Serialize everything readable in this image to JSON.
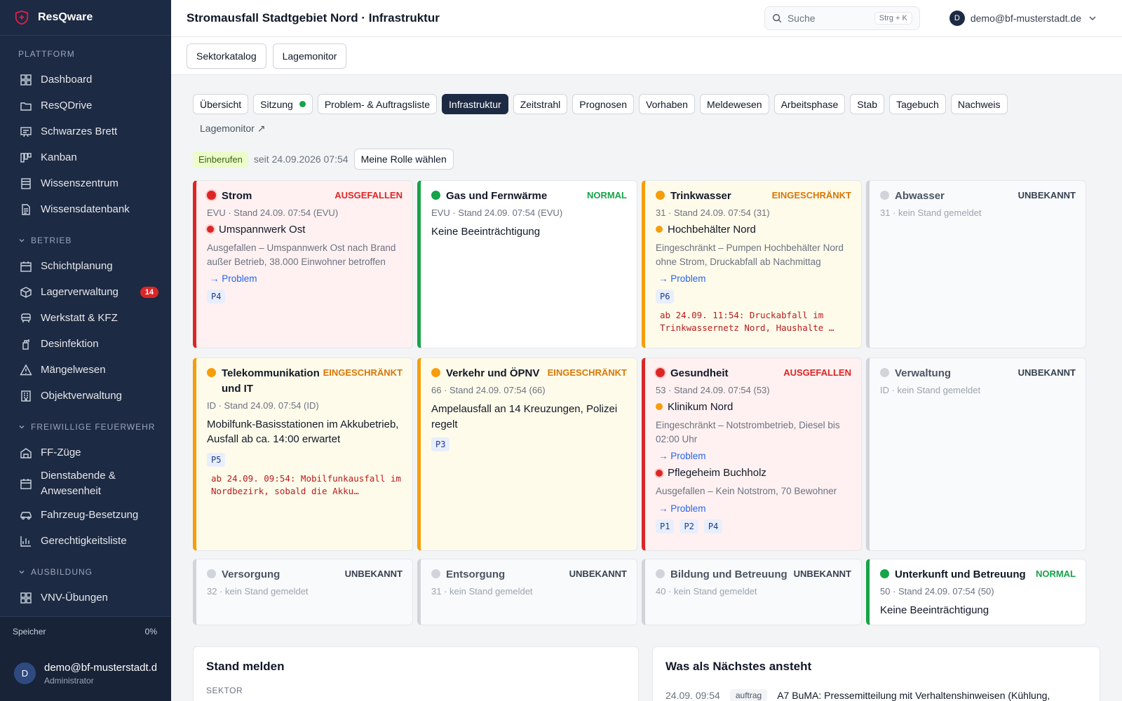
{
  "brand": {
    "name": "ResQware"
  },
  "sidebar": {
    "sections": [
      {
        "title": "PLATTFORM",
        "collapsible": false,
        "items": [
          {
            "label": "Dashboard",
            "icon": "dashboard-icon"
          },
          {
            "label": "ResQDrive",
            "icon": "folder-icon"
          },
          {
            "label": "Schwarzes Brett",
            "icon": "board-icon"
          },
          {
            "label": "Kanban",
            "icon": "kanban-icon"
          },
          {
            "label": "Wissenszentrum",
            "icon": "book-icon"
          },
          {
            "label": "Wissensdatenbank",
            "icon": "document-icon"
          }
        ]
      },
      {
        "title": "BETRIEB",
        "collapsible": true,
        "items": [
          {
            "label": "Schichtplanung",
            "icon": "calendar-icon"
          },
          {
            "label": "Lagerverwaltung",
            "icon": "box-icon",
            "badge": "14"
          },
          {
            "label": "Werkstatt & KFZ",
            "icon": "vehicle-icon"
          },
          {
            "label": "Desinfektion",
            "icon": "spray-icon"
          },
          {
            "label": "Mängelwesen",
            "icon": "warning-icon"
          },
          {
            "label": "Objektverwaltung",
            "icon": "building-icon"
          }
        ]
      },
      {
        "title": "FREIWILLIGE FEUERWEHR",
        "collapsible": true,
        "items": [
          {
            "label": "FF-Züge",
            "icon": "firehouse-icon"
          },
          {
            "label": "Dienstabende & Anwesenheit",
            "icon": "calendar-icon"
          },
          {
            "label": "Fahrzeug-Besetzung",
            "icon": "car-icon"
          },
          {
            "label": "Gerechtigkeitsliste",
            "icon": "bar-chart-icon"
          }
        ]
      },
      {
        "title": "AUSBILDUNG",
        "collapsible": true,
        "items": [
          {
            "label": "VNV-Übungen",
            "icon": "grid-icon"
          }
        ]
      }
    ],
    "storage": {
      "label": "Speicher",
      "value": "0%"
    },
    "user": {
      "initial": "D",
      "name": "demo@bf-musterstadt.de",
      "role": "Administrator"
    }
  },
  "topbar": {
    "title": "Stromausfall Stadtgebiet Nord · Infrastruktur",
    "search": {
      "placeholder": "Suche",
      "shortcut": "Strg + K"
    },
    "account": {
      "initial": "D",
      "email": "demo@bf-musterstadt.de"
    }
  },
  "subbar": {
    "buttons": [
      "Sektorkatalog",
      "Lagemonitor"
    ]
  },
  "tabs": [
    {
      "label": "Übersicht"
    },
    {
      "label": "Sitzung",
      "live": true
    },
    {
      "label": "Problem- & Auftragsliste"
    },
    {
      "label": "Infrastruktur",
      "active": true
    },
    {
      "label": "Zeitstrahl"
    },
    {
      "label": "Prognosen"
    },
    {
      "label": "Vorhaben"
    },
    {
      "label": "Meldewesen"
    },
    {
      "label": "Arbeitsphase"
    },
    {
      "label": "Stab"
    },
    {
      "label": "Tagebuch"
    },
    {
      "label": "Nachweis"
    }
  ],
  "tab_link": "Lagemonitor ↗",
  "session": {
    "status": "Einberufen",
    "since": "seit 24.09.2026 07:54",
    "role_button": "Meine Rolle wählen"
  },
  "colors": {
    "ausgefallen": "#dc2626",
    "normal": "#16a34a",
    "eingeschraenkt": "#f59e0b",
    "unbekannt": "#d1d5db",
    "sidebar": "#1d2a43"
  },
  "sectors": [
    {
      "name": "Strom",
      "status": "AUSGEFALLEN",
      "tone": "red",
      "meta": "EVU · Stand 24.09. 07:54 (EVU)",
      "facilities": [
        {
          "name": "Umspannwerk Ost",
          "tone": "red",
          "desc": "Ausgefallen – Umspannwerk Ost nach Brand außer Betrieb, 38.000 Einwohner betroffen",
          "link": "→ Problem"
        }
      ],
      "tags": [
        "P4"
      ]
    },
    {
      "name": "Gas und Fernwärme",
      "status": "NORMAL",
      "tone": "green",
      "meta": "EVU · Stand 24.09. 07:54 (EVU)",
      "text": "Keine Beeinträchtigung"
    },
    {
      "name": "Trinkwasser",
      "status": "EINGESCHRÄNKT",
      "tone": "amber",
      "meta": "31 · Stand 24.09. 07:54 (31)",
      "facilities": [
        {
          "name": "Hochbehälter Nord",
          "tone": "amber",
          "desc": "Eingeschränkt – Pumpen Hochbehälter Nord ohne Strom, Druckabfall ab Nachmittag",
          "link": "→ Problem"
        }
      ],
      "tags": [
        "P6"
      ],
      "note": "ab 24.09. 11:54: Druckabfall im Trinkwassernetz Nord, Haushalte …"
    },
    {
      "name": "Abwasser",
      "status": "UNBEKANNT",
      "tone": "gray",
      "meta": "31 · kein Stand gemeldet"
    },
    {
      "name": "Telekommunikation und IT",
      "status": "EINGESCHRÄNKT",
      "tone": "amber",
      "meta": "ID · Stand 24.09. 07:54 (ID)",
      "text": "Mobilfunk-Basisstationen im Akkubetrieb, Ausfall ab ca. 14:00 erwartet",
      "tags": [
        "P5"
      ],
      "note": "ab 24.09. 09:54: Mobilfunkausfall im Nordbezirk, sobald die Akku…"
    },
    {
      "name": "Verkehr und ÖPNV",
      "status": "EINGESCHRÄNKT",
      "tone": "amber",
      "meta": "66 · Stand 24.09. 07:54 (66)",
      "text": "Ampelausfall an 14 Kreuzungen, Polizei regelt",
      "tags": [
        "P3"
      ]
    },
    {
      "name": "Gesundheit",
      "status": "AUSGEFALLEN",
      "tone": "red",
      "meta": "53 · Stand 24.09. 07:54 (53)",
      "facilities": [
        {
          "name": "Klinikum Nord",
          "tone": "amber",
          "desc": "Eingeschränkt – Notstrombetrieb, Diesel bis 02:00 Uhr",
          "link": "→ Problem"
        },
        {
          "name": "Pflegeheim Buchholz",
          "tone": "red",
          "desc": "Ausgefallen – Kein Notstrom, 70 Bewohner",
          "link": "→ Problem"
        }
      ],
      "tags": [
        "P1",
        "P2",
        "P4"
      ]
    },
    {
      "name": "Verwaltung",
      "status": "UNBEKANNT",
      "tone": "gray",
      "meta": "ID · kein Stand gemeldet"
    },
    {
      "name": "Versorgung",
      "status": "UNBEKANNT",
      "tone": "gray",
      "meta": "32 · kein Stand gemeldet"
    },
    {
      "name": "Entsorgung",
      "status": "UNBEKANNT",
      "tone": "gray",
      "meta": "31 · kein Stand gemeldet"
    },
    {
      "name": "Bildung und Betreuung",
      "status": "UNBEKANNT",
      "tone": "gray",
      "meta": "40 · kein Stand gemeldet"
    },
    {
      "name": "Unterkunft und Betreuung",
      "status": "NORMAL",
      "tone": "green",
      "meta": "50 · Stand 24.09. 07:54 (50)",
      "text": "Keine Beeinträchtigung"
    }
  ],
  "report_panel": {
    "title": "Stand melden",
    "label": "SEKTOR"
  },
  "next_panel": {
    "title": "Was als Nächstes ansteht",
    "items": [
      {
        "time": "24.09. 09:54",
        "type": "auftrag",
        "text": "A7 BuMA: Pressemitteilung mit Verhaltenshinweisen (Kühlung,"
      }
    ]
  }
}
